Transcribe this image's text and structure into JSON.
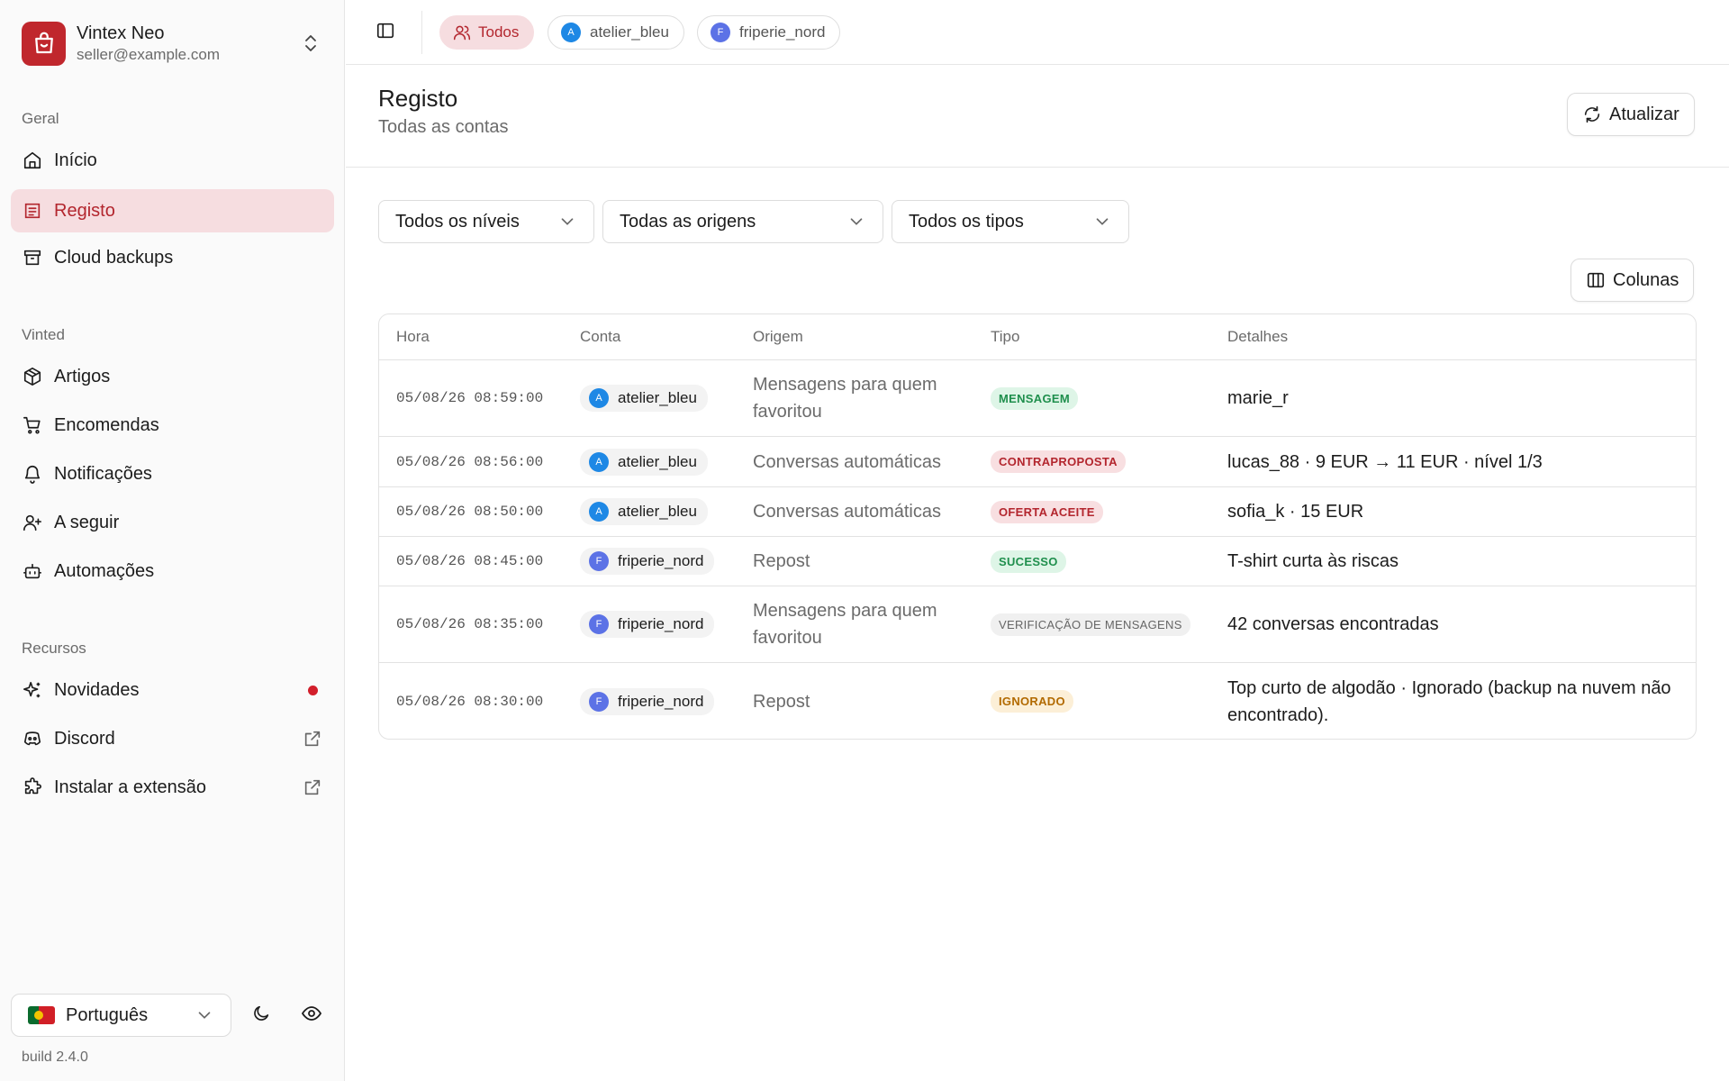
{
  "brand": {
    "name": "Vintex Neo",
    "email": "seller@example.com"
  },
  "sidebar": {
    "groups": [
      {
        "label": "Geral"
      },
      {
        "label": "Vinted"
      },
      {
        "label": "Recursos"
      }
    ],
    "items": [
      {
        "label": "Início",
        "icon": "home-icon"
      },
      {
        "label": "Registo",
        "icon": "log-icon",
        "active": true
      },
      {
        "label": "Cloud backups",
        "icon": "archive-icon"
      },
      {
        "label": "Artigos",
        "icon": "package-icon"
      },
      {
        "label": "Encomendas",
        "icon": "cart-icon"
      },
      {
        "label": "Notificações",
        "icon": "bell-icon"
      },
      {
        "label": "A seguir",
        "icon": "user-plus-icon"
      },
      {
        "label": "Automações",
        "icon": "bot-icon"
      },
      {
        "label": "Novidades",
        "icon": "sparkles-icon"
      },
      {
        "label": "Discord",
        "icon": "discord-icon"
      },
      {
        "label": "Instalar a extensão",
        "icon": "puzzle-icon"
      }
    ],
    "language": "Português",
    "build": "build 2.4.0"
  },
  "topbar": {
    "chips": [
      {
        "label": "Todos",
        "active": true
      },
      {
        "label": "atelier_bleu",
        "initial": "A"
      },
      {
        "label": "friperie_nord",
        "initial": "F"
      }
    ]
  },
  "header": {
    "title": "Registo",
    "subtitle": "Todas as contas",
    "refresh_label": "Atualizar"
  },
  "filters": {
    "level": "Todos os níveis",
    "origin": "Todas as origens",
    "type": "Todos os tipos",
    "columns_label": "Colunas"
  },
  "table": {
    "columns": [
      "Hora",
      "Conta",
      "Origem",
      "Tipo",
      "Detalhes"
    ],
    "rows": [
      {
        "time": "05/08/26 08:59:00",
        "account": "atelier_bleu",
        "initial": "A",
        "origin": "Mensagens para quem favoritou",
        "type": "MENSAGEM",
        "details": "marie_r"
      },
      {
        "time": "05/08/26 08:56:00",
        "account": "atelier_bleu",
        "initial": "A",
        "origin": "Conversas automáticas",
        "type": "CONTRAPROPOSTA",
        "details": "lucas_88 · 9 EUR → 11 EUR · nível 1/3"
      },
      {
        "time": "05/08/26 08:50:00",
        "account": "atelier_bleu",
        "initial": "A",
        "origin": "Conversas automáticas",
        "type": "OFERTA ACEITE",
        "details": "sofia_k · 15 EUR"
      },
      {
        "time": "05/08/26 08:45:00",
        "account": "friperie_nord",
        "initial": "F",
        "origin": "Repost",
        "type": "SUCESSO",
        "details": "T-shirt curta às riscas"
      },
      {
        "time": "05/08/26 08:35:00",
        "account": "friperie_nord",
        "initial": "F",
        "origin": "Mensagens para quem favoritou",
        "type": "VERIFICAÇÃO DE MENSAGENS",
        "details": "42 conversas encontradas"
      },
      {
        "time": "05/08/26 08:30:00",
        "account": "friperie_nord",
        "initial": "F",
        "origin": "Repost",
        "type": "IGNORADO",
        "details": "Top curto de algodão · Ignorado (backup na nuvem não encontrado)."
      }
    ]
  },
  "colors": {
    "accent": "#b3262e",
    "accent_bg": "#f6dde0",
    "brand": "#c0272d"
  }
}
